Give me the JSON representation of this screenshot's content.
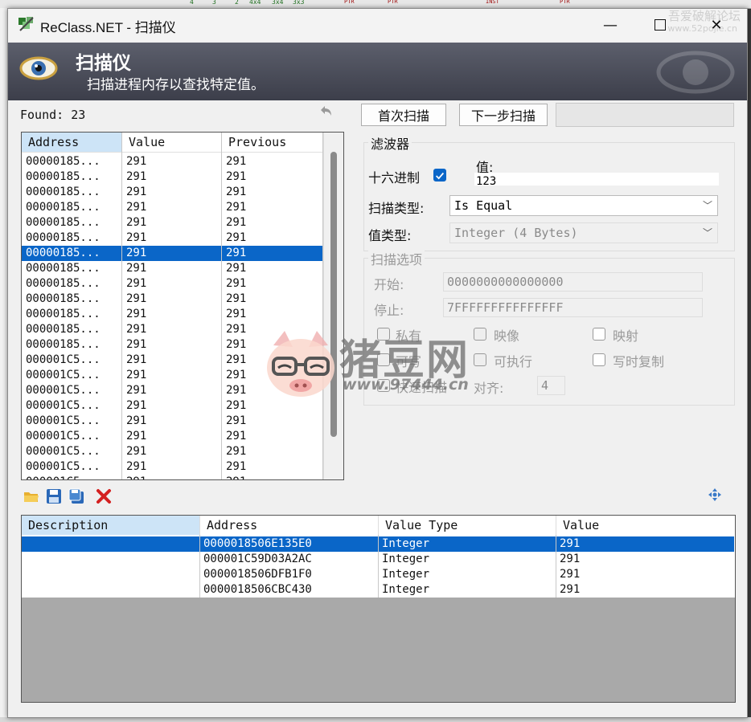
{
  "window": {
    "title": "ReClass.NET - 扫描仪",
    "watermark_top": "吾爱破解论坛",
    "watermark_top_url": "www.52pojie.cn"
  },
  "header": {
    "title": "扫描仪",
    "subtitle": "扫描进程内存以查找特定值。"
  },
  "found": {
    "text": "Found: 23"
  },
  "results": {
    "columns": [
      "Address",
      "Value",
      "Previous"
    ],
    "selected_index": 6,
    "rows": [
      [
        "00000185...",
        "291",
        "291"
      ],
      [
        "00000185...",
        "291",
        "291"
      ],
      [
        "00000185...",
        "291",
        "291"
      ],
      [
        "00000185...",
        "291",
        "291"
      ],
      [
        "00000185...",
        "291",
        "291"
      ],
      [
        "00000185...",
        "291",
        "291"
      ],
      [
        "00000185...",
        "291",
        "291"
      ],
      [
        "00000185...",
        "291",
        "291"
      ],
      [
        "00000185...",
        "291",
        "291"
      ],
      [
        "00000185...",
        "291",
        "291"
      ],
      [
        "00000185...",
        "291",
        "291"
      ],
      [
        "00000185...",
        "291",
        "291"
      ],
      [
        "00000185...",
        "291",
        "291"
      ],
      [
        "000001C5...",
        "291",
        "291"
      ],
      [
        "000001C5...",
        "291",
        "291"
      ],
      [
        "000001C5...",
        "291",
        "291"
      ],
      [
        "000001C5...",
        "291",
        "291"
      ],
      [
        "000001C5...",
        "291",
        "291"
      ],
      [
        "000001C5...",
        "291",
        "291"
      ],
      [
        "000001C5...",
        "291",
        "291"
      ],
      [
        "000001C5...",
        "291",
        "291"
      ],
      [
        "000001C5...",
        "291",
        "291"
      ]
    ]
  },
  "buttons": {
    "first_scan": "首次扫描",
    "next_scan": "下一步扫描"
  },
  "filter": {
    "title": "滤波器",
    "hex_label": "十六进制",
    "hex_checked": true,
    "value_label": "值:",
    "value": "123",
    "scan_type_label": "扫描类型:",
    "scan_type": "Is Equal",
    "value_type_label": "值类型:",
    "value_type": "Integer (4 Bytes)"
  },
  "scan_options": {
    "title": "扫描选项",
    "start_label": "开始:",
    "start": "0000000000000000",
    "stop_label": "停止:",
    "stop": "7FFFFFFFFFFFFFFF",
    "private_label": "私有",
    "image_label": "映像",
    "mapped_label": "映射",
    "writable_label": "可写",
    "executable_label": "可执行",
    "copy_on_write_label": "写时复制",
    "fast_scan_label": "快速扫描",
    "align_label": "对齐:",
    "align": "4"
  },
  "saved": {
    "columns": [
      "Description",
      "Address",
      "Value Type",
      "Value"
    ],
    "selected_index": 0,
    "rows": [
      [
        "",
        "0000018506E135E0",
        "Integer",
        "291"
      ],
      [
        "",
        "000001C59D03A2AC",
        "Integer",
        "291"
      ],
      [
        "",
        "0000018506DFB1F0",
        "Integer",
        "291"
      ],
      [
        "",
        "0000018506CBC430",
        "Integer",
        "291"
      ]
    ]
  },
  "watermark": {
    "text": "猪豆网",
    "url": "www.97444.cn"
  },
  "colors": {
    "selection": "#0a66c8",
    "header_bg": "#4a4c58",
    "delete_red": "#d42020"
  }
}
